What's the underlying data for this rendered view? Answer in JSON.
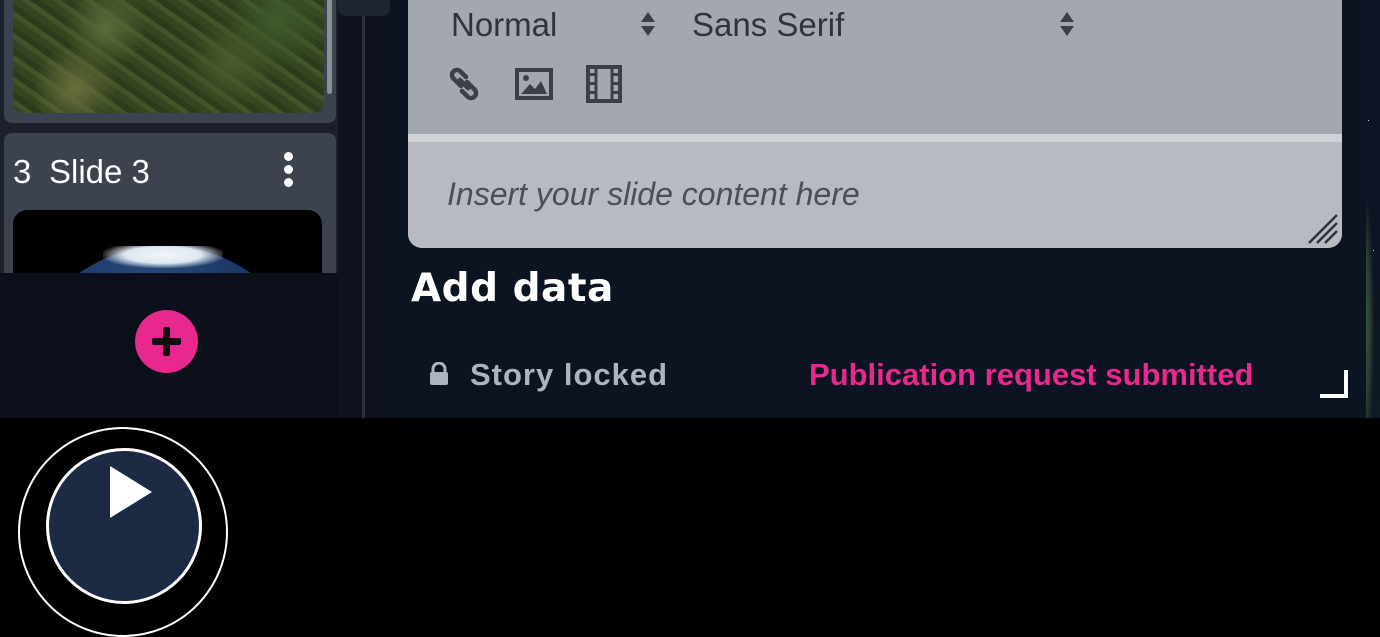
{
  "slides": [
    {
      "number": "3",
      "title": "Slide 3",
      "menu_icon": "more-vertical-icon"
    }
  ],
  "slide_panel": {
    "add_button_icon": "plus-icon"
  },
  "editor": {
    "format_select": "Normal",
    "font_select": "Sans Serif",
    "toolbar_icons": [
      "link-icon",
      "image-icon",
      "video-icon"
    ],
    "placeholder": "Insert your slide content here"
  },
  "section": {
    "add_data": "Add data"
  },
  "status": {
    "lock_label": "Story locked",
    "publication": "Publication request submitted",
    "publication_color": "#e8288c"
  },
  "player": {
    "icon": "play-icon"
  }
}
